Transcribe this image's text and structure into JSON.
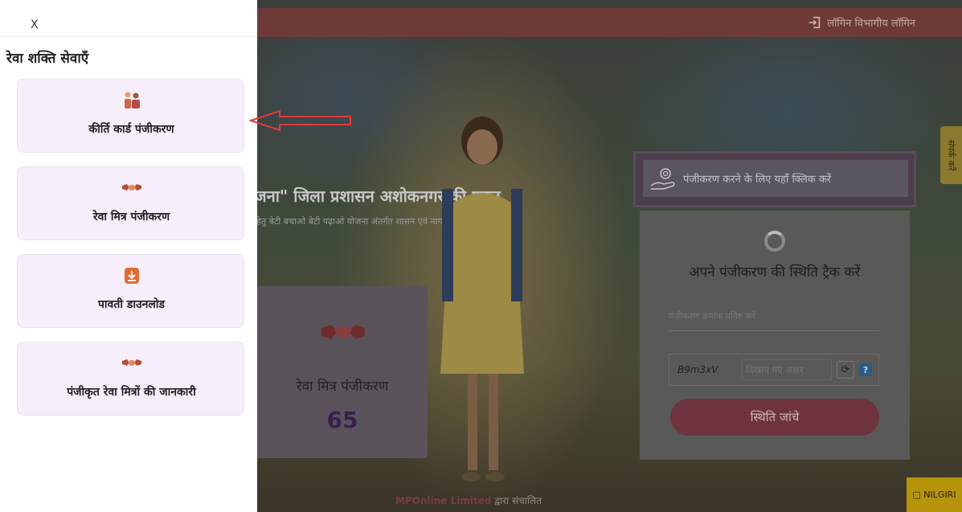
{
  "drawer": {
    "close_label": "X",
    "title": "रेवा शक्ति सेवाएँ",
    "items": [
      {
        "label": "कीर्ति कार्ड पंजीकरण",
        "icon": "family-icon"
      },
      {
        "label": "रेवा मित्र पंजीकरण",
        "icon": "handshake-icon"
      },
      {
        "label": "पावती डाउनलोड",
        "icon": "download-icon"
      },
      {
        "label": "पंजीकृत रेवा मित्रों की जानकारी",
        "icon": "handshake-icon"
      }
    ]
  },
  "header": {
    "login_label": "लॉगिन विभागीय लॉगिन",
    "login_icon": "login-icon"
  },
  "hero": {
    "title": "योजना\" जिला प्रशासन अशोकनगर की पहल",
    "subtitle": "ाने हेतु बेटी बचाओ बेटी पढ़ाओ योजना अंतर्गत शासन एवं नागरिक सहभागिता"
  },
  "register_banner": {
    "label": "पंजीकरण करने के लिए यहाँ क्लिक करें",
    "icon": "hand-gear-icon"
  },
  "tracker": {
    "title": "अपने पंजीकरण की स्थिति ट्रैक करें",
    "reg_placeholder": "पंजीकरण क्रमांक प्रविष्ट करें",
    "captcha_code": "B9m3xV",
    "captcha_placeholder": "दिखाए गए अक्षर",
    "refresh_icon": "refresh-icon",
    "help_label": "?",
    "submit_label": "स्थिति जांचे"
  },
  "stat_card": {
    "label": "रेवा मित्र पंजीकरण",
    "count": "65",
    "icon": "handshake-icon"
  },
  "side_tab": {
    "label": "संपर्क करें"
  },
  "footer": {
    "brand": "MPOnline Limited",
    "suffix": " द्वारा संचालित"
  },
  "nilgiri": {
    "label": "□ NILGIRI"
  },
  "colors": {
    "drawer_card_bg": "#f6eefb",
    "topbar": "#6d3a38",
    "submit": "#6f3340",
    "arrow": "#e03a3a",
    "stat_count": "#3b1e4a"
  }
}
